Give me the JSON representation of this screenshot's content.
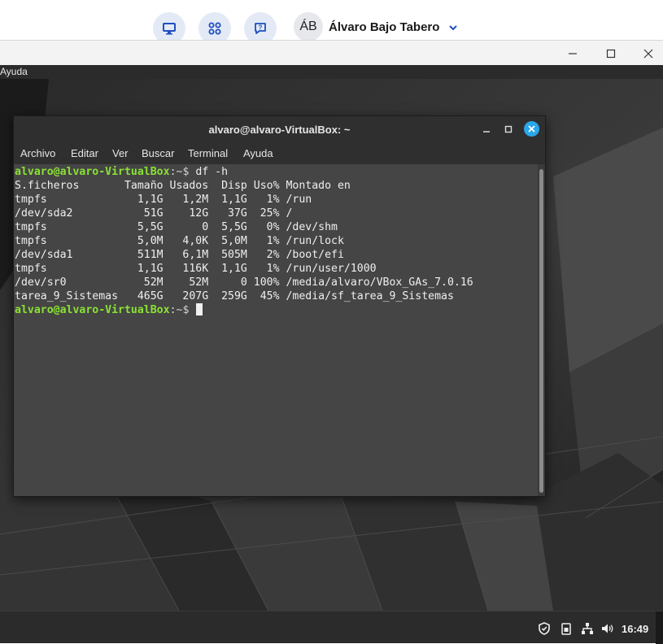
{
  "host": {
    "buttons": [
      {
        "name": "desktop-icon"
      },
      {
        "name": "apps-grid-icon"
      },
      {
        "name": "help-chat-icon"
      }
    ],
    "user_initials": "ÁB",
    "user_name": "Álvaro Bajo Tabero"
  },
  "vm": {
    "menu": {
      "help_label": "Ayuda"
    }
  },
  "terminal": {
    "title": "alvaro@alvaro-VirtualBox: ~",
    "menu": [
      "Archivo",
      "Editar",
      "Ver",
      "Buscar",
      "Terminal",
      "Ayuda"
    ],
    "prompt_user": "alvaro@alvaro-VirtualBox",
    "prompt_path": ":~$ ",
    "command": "df -h",
    "output_lines": [
      "S.ficheros       Tamaño Usados  Disp Uso% Montado en",
      "tmpfs              1,1G   1,2M  1,1G   1% /run",
      "/dev/sda2           51G    12G   37G  25% /",
      "tmpfs              5,5G      0  5,5G   0% /dev/shm",
      "tmpfs              5,0M   4,0K  5,0M   1% /run/lock",
      "/dev/sda1          511M   6,1M  505M   2% /boot/efi",
      "tmpfs              1,1G   116K  1,1G   1% /run/user/1000",
      "/dev/sr0            52M    52M     0 100% /media/alvaro/VBox_GAs_7.0.16",
      "tarea_9_Sistemas   465G   207G  259G  45% /media/sf_tarea_9_Sistemas"
    ]
  },
  "taskbar": {
    "tray_icons": [
      "shield-icon",
      "clipboard-icon",
      "network-icon",
      "volume-icon"
    ],
    "clock": "16:49"
  },
  "colors": {
    "prompt_user": "#8ae234",
    "close_button": "#2aa7e8",
    "host_button_bg": "#e3eaf6",
    "icon_blue": "#1f4fbf"
  }
}
